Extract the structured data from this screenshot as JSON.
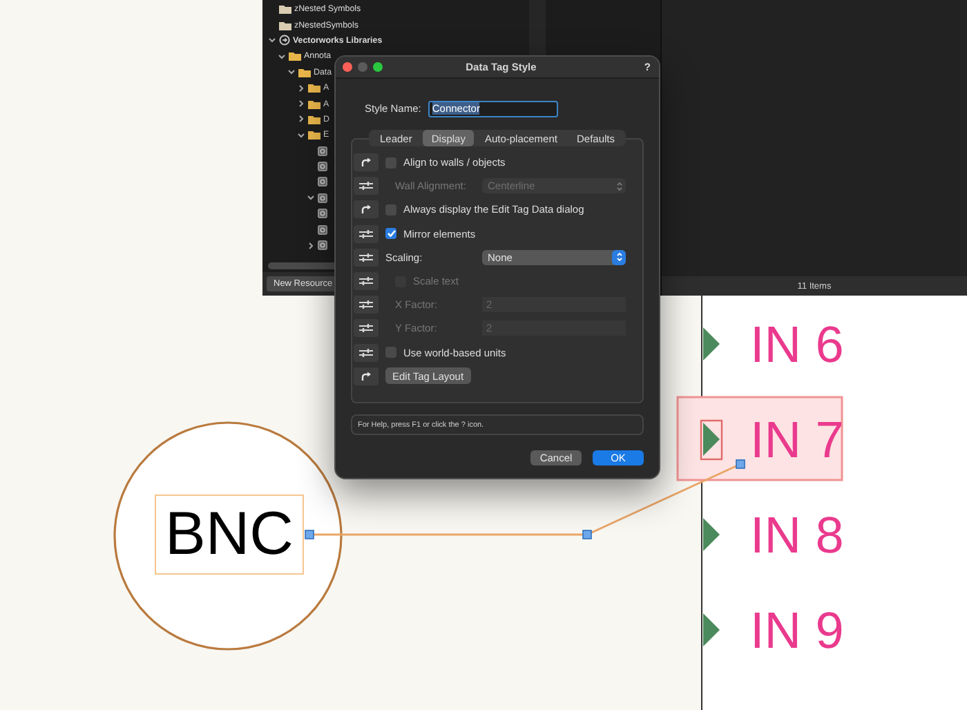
{
  "tree": [
    {
      "label": "zNested Symbols",
      "kind": "symbol_folder"
    },
    {
      "label": "zNestedSymbols",
      "kind": "symbol_folder"
    },
    {
      "label": "Vectorworks Libraries",
      "kind": "library",
      "expanded": true,
      "children": [
        {
          "label": "Annota",
          "kind": "folder",
          "expanded": true,
          "children": [
            {
              "label": "Data",
              "kind": "folder",
              "expanded": true,
              "children": [
                {
                  "label": "A",
                  "kind": "folder",
                  "expanded": false
                },
                {
                  "label": "A",
                  "kind": "folder",
                  "expanded": false
                },
                {
                  "label": "D",
                  "kind": "folder",
                  "expanded": false
                },
                {
                  "label": "E",
                  "kind": "folder",
                  "expanded": true,
                  "children": [
                    {
                      "kind": "resource"
                    },
                    {
                      "kind": "resource"
                    },
                    {
                      "kind": "resource"
                    },
                    {
                      "kind": "resource",
                      "expanded": true
                    },
                    {
                      "kind": "resource"
                    },
                    {
                      "kind": "resource"
                    },
                    {
                      "kind": "resource",
                      "expanded": false
                    }
                  ]
                }
              ]
            }
          ]
        }
      ]
    }
  ],
  "status_bar": {
    "button": "New Resource",
    "item_count": "11 Items"
  },
  "dialog": {
    "title": "Data Tag Style",
    "help_mark": "?",
    "style_name": {
      "label": "Style Name:",
      "value": "Connector"
    },
    "tabs": [
      {
        "label": "Leader",
        "selected": false
      },
      {
        "label": "Display",
        "selected": true
      },
      {
        "label": "Auto-placement",
        "selected": false
      },
      {
        "label": "Defaults",
        "selected": false
      }
    ],
    "rows": [
      {
        "kind": "checkbox",
        "label": "Align to walls / objects",
        "checked": false,
        "disabled": false
      },
      {
        "kind": "select",
        "label": "Wall Alignment:",
        "value": "Centerline",
        "disabled": true
      },
      {
        "kind": "checkbox",
        "label": "Always display the Edit Tag Data dialog",
        "checked": false,
        "disabled": false
      },
      {
        "kind": "checkbox",
        "label": "Mirror elements",
        "checked": true,
        "disabled": false
      },
      {
        "kind": "select",
        "label": "Scaling:",
        "value": "None",
        "disabled": false
      },
      {
        "kind": "checkbox",
        "label": "Scale text",
        "checked": false,
        "disabled": true
      },
      {
        "kind": "field",
        "label": "X Factor:",
        "value": "2",
        "disabled": true
      },
      {
        "kind": "field",
        "label": "Y Factor:",
        "value": "2",
        "disabled": true
      },
      {
        "kind": "checkbox",
        "label": "Use world-based units",
        "checked": false,
        "disabled": false
      },
      {
        "kind": "button",
        "label": "Edit Tag Layout",
        "disabled": false
      }
    ],
    "help_text": "For Help, press F1 or click the ? icon.",
    "buttons": [
      {
        "label": "Cancel",
        "default": false
      },
      {
        "label": "OK",
        "default": true
      }
    ]
  },
  "drawing": {
    "tag": "BNC",
    "ports": [
      {
        "label": "IN 6",
        "selected": false
      },
      {
        "label": "IN 7",
        "selected": true
      },
      {
        "label": "IN 8",
        "selected": false
      },
      {
        "label": "IN 9",
        "selected": false
      }
    ]
  }
}
